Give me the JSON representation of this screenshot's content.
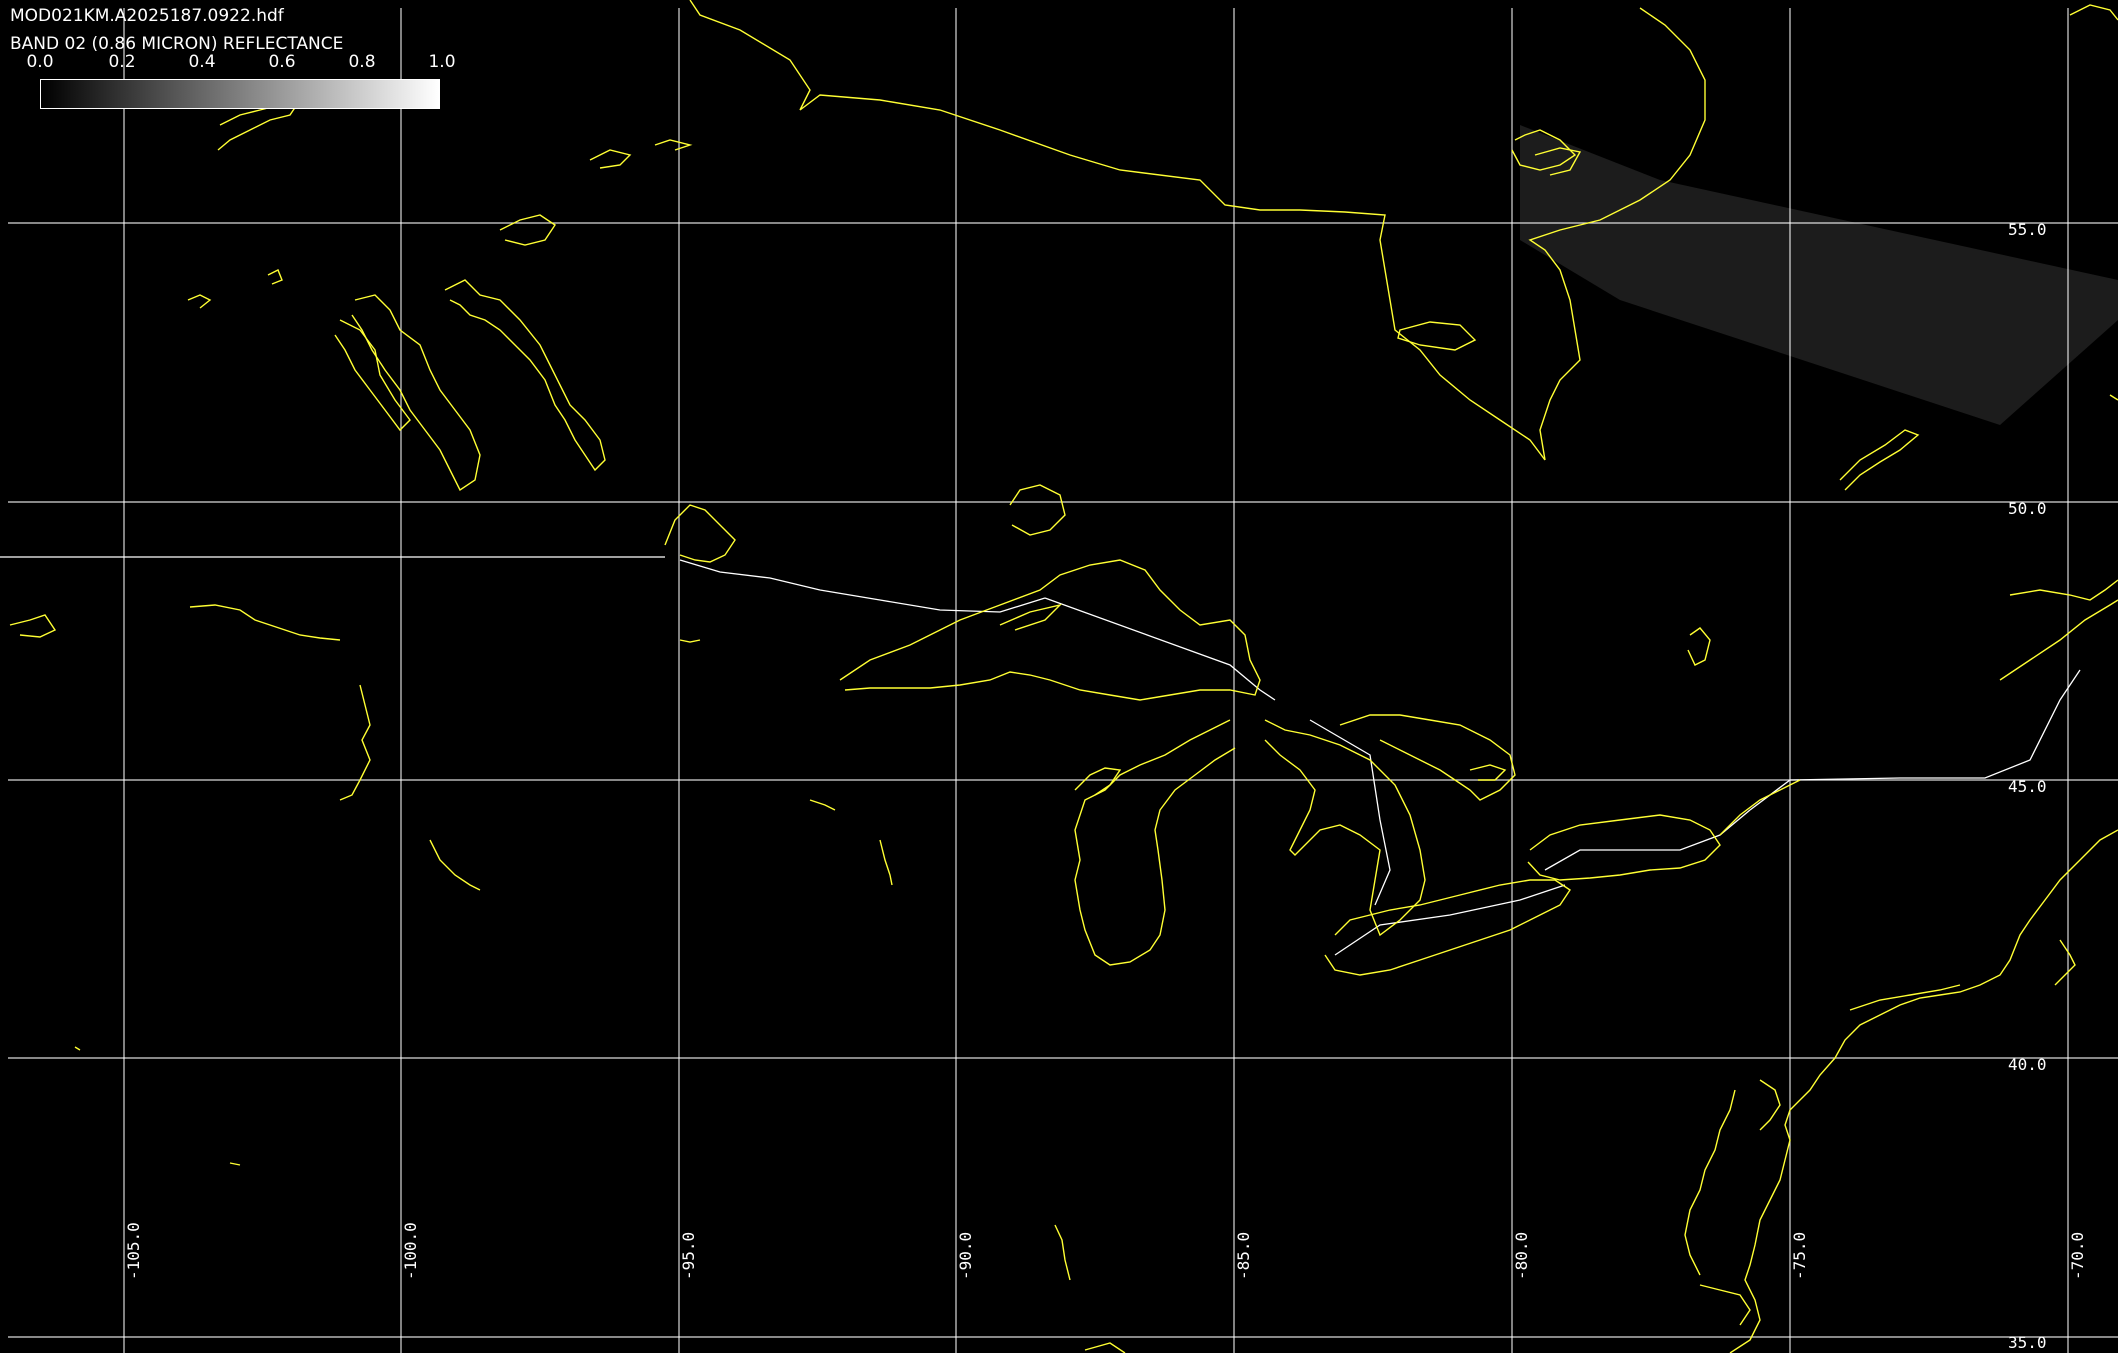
{
  "header": {
    "file_name": "MOD021KM.A2025187.0922.hdf",
    "band_label": "BAND 02 (0.86 MICRON) REFLECTANCE"
  },
  "colorbar": {
    "ticks": [
      "0.0",
      "0.2",
      "0.4",
      "0.6",
      "0.8",
      "1.0"
    ],
    "range": [
      0.0,
      1.0
    ],
    "colormap": "grayscale"
  },
  "grid": {
    "latitude_labels": [
      "55.0",
      "50.0",
      "45.0",
      "40.0",
      "35.0"
    ],
    "longitude_labels": [
      "-105.0",
      "-100.0",
      "-95.0",
      "-90.0",
      "-85.0",
      "-80.0",
      "-75.0",
      "-70.0"
    ]
  },
  "colors": {
    "background": "#000000",
    "coastline": "#ffff33",
    "borders": "#ffffff",
    "gridlines": "#ffffff",
    "swath": "#2a2a2a"
  }
}
